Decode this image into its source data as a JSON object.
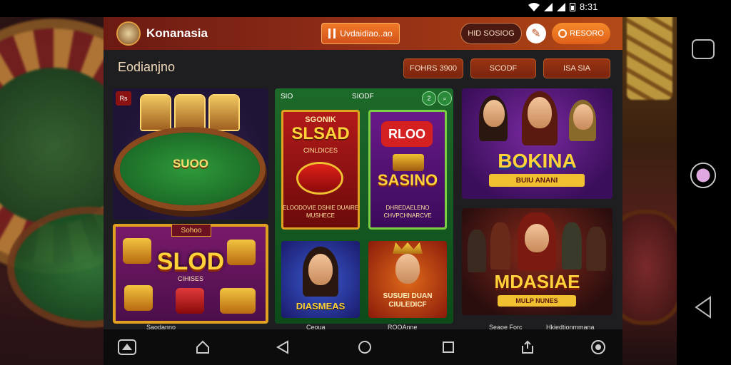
{
  "status_bar": {
    "time": "8:31"
  },
  "header": {
    "brand": "Konanasia",
    "promo_button": "Uvdaidiao..ao",
    "login_button": "HID SOSIOG",
    "register_button": "RESORO"
  },
  "section": {
    "title": "Eodianjno",
    "filters": [
      "FOHRS 3900",
      "SCODF",
      "ISA SIA"
    ]
  },
  "tiles": {
    "poker": {
      "badge": "Rs",
      "label": "SUOO"
    },
    "slots_big": {
      "tag": "Sohoo",
      "label": "SLOD",
      "sub": "CIHISES"
    },
    "middle_header": {
      "left": "SIO",
      "mid": "SIODF"
    },
    "slsad": {
      "title_top": "SGONIK",
      "label": "SLSAD",
      "sub": "CINLDICES",
      "foot": "ELOODOVIE DSHIE\nDUAIRE MUSHECE"
    },
    "roo": {
      "top": "RLOO",
      "label": "SASINO",
      "foot": "DHREDAELENO\nCHVPCHNARCVE"
    },
    "diasmas": {
      "label": "DIASMEAS"
    },
    "sugar": {
      "label": "SUSUEI DUAN\nCIULEDICF"
    },
    "bonina": {
      "label": "BOKINA",
      "sub": "BUIU ANANI"
    },
    "mdasiae": {
      "label": "MDASIAE",
      "sub": "MULP NUNES"
    }
  },
  "captions": [
    "Saodanno",
    "Ceoua",
    "ROOAnne",
    "Seaoe Forc",
    "Hkiedtionmmana"
  ],
  "colors": {
    "header_start": "#6b1a12",
    "header_end": "#b24a18",
    "accent": "#f07a28",
    "gold": "#ffd23a"
  }
}
